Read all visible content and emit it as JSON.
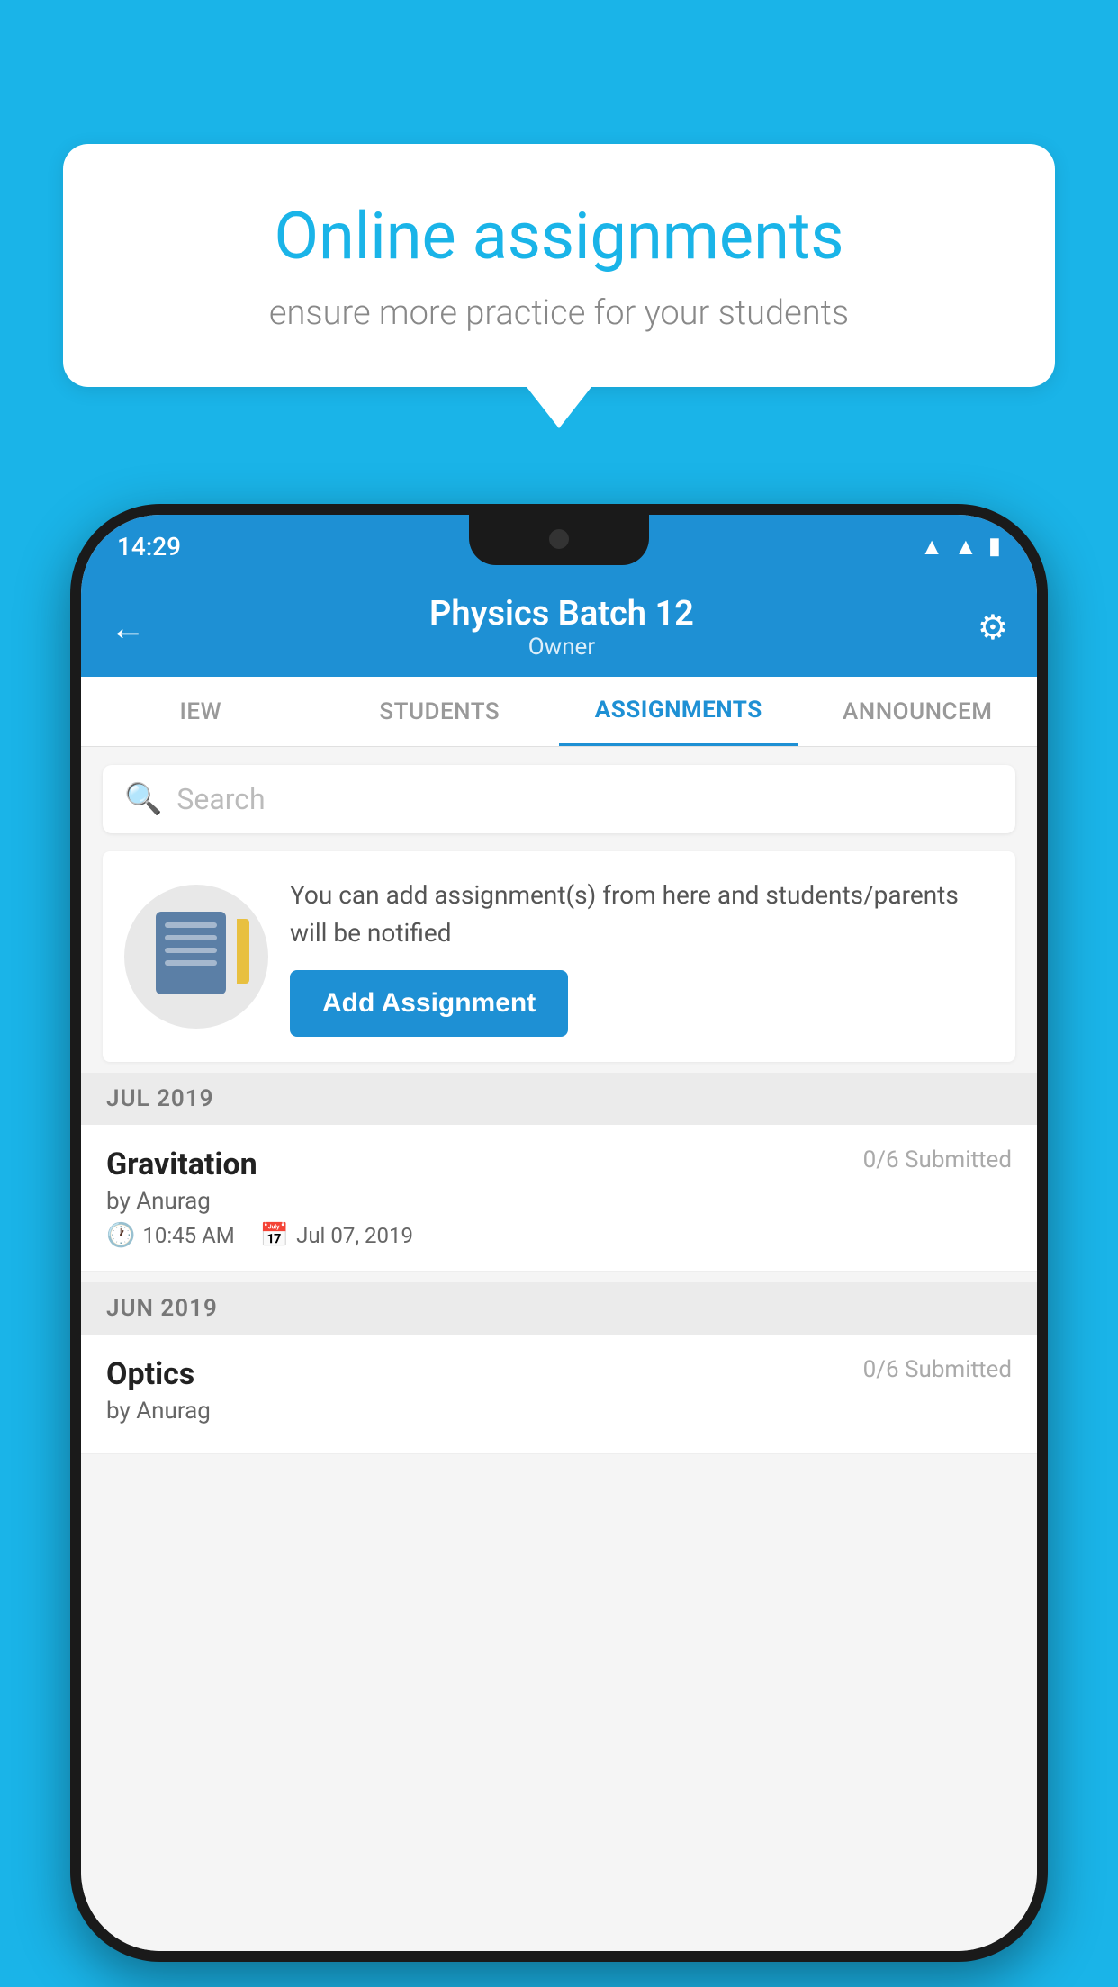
{
  "background_color": "#1ab4e8",
  "bubble": {
    "title": "Online assignments",
    "subtitle": "ensure more practice for your students"
  },
  "status_bar": {
    "time": "14:29",
    "icons": [
      "wifi",
      "signal",
      "battery"
    ]
  },
  "header": {
    "title": "Physics Batch 12",
    "subtitle": "Owner",
    "back_label": "←",
    "settings_label": "⚙"
  },
  "tabs": [
    {
      "label": "IEW",
      "active": false
    },
    {
      "label": "STUDENTS",
      "active": false
    },
    {
      "label": "ASSIGNMENTS",
      "active": true
    },
    {
      "label": "ANNOUNCEM",
      "active": false
    }
  ],
  "search": {
    "placeholder": "Search"
  },
  "promo": {
    "description": "You can add assignment(s) from here and students/parents will be notified",
    "button_label": "Add Assignment"
  },
  "sections": [
    {
      "month_label": "JUL 2019",
      "assignments": [
        {
          "name": "Gravitation",
          "submitted": "0/6 Submitted",
          "by": "by Anurag",
          "time": "10:45 AM",
          "date": "Jul 07, 2019"
        }
      ]
    },
    {
      "month_label": "JUN 2019",
      "assignments": [
        {
          "name": "Optics",
          "submitted": "0/6 Submitted",
          "by": "by Anurag",
          "time": "",
          "date": ""
        }
      ]
    }
  ]
}
